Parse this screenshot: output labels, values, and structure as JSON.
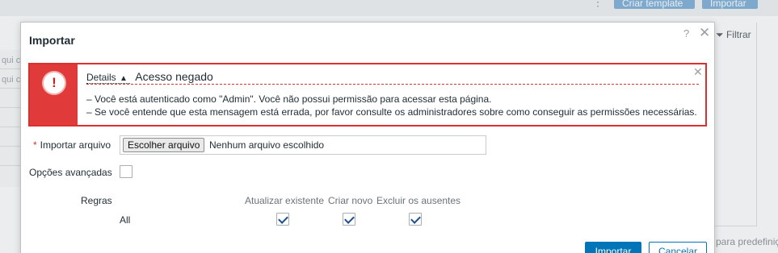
{
  "background": {
    "top_button_1": "Criar template",
    "top_button_2": "Importar",
    "left_rows": [
      "qui c",
      "qui c"
    ],
    "filter_label": "Filtrar",
    "bottom_text": "para predefiniç"
  },
  "dialog": {
    "title": "Importar",
    "help_glyph": "?",
    "close_glyph": "✕"
  },
  "error": {
    "icon_glyph": "!",
    "details_label": "Details",
    "details_caret": "▲",
    "title": "Acesso negado",
    "close_glyph": "✕",
    "messages": [
      "–  Você está autenticado como \"Admin\". Você não possui permissão para acessar esta página.",
      "–  Se você entende que esta mensagem está errada, por favor consulte os administradores sobre como conseguir as permissões necessárias."
    ]
  },
  "form": {
    "required_mark": "*",
    "file_label": "Importar arquivo",
    "file_button": "Escolher arquivo",
    "file_status": "Nenhum arquivo escolhido",
    "advanced_label": "Opções avançadas",
    "advanced_checked": false,
    "rules_label": "Regras",
    "columns": [
      "Atualizar existente",
      "Criar novo",
      "Excluir os ausentes"
    ],
    "row_label": "All",
    "row_checks": [
      true,
      true,
      true
    ]
  },
  "buttons": {
    "import": "Importar",
    "cancel": "Cancelar"
  },
  "colors": {
    "primary": "#0275b8",
    "error": "#dc2f2f"
  }
}
